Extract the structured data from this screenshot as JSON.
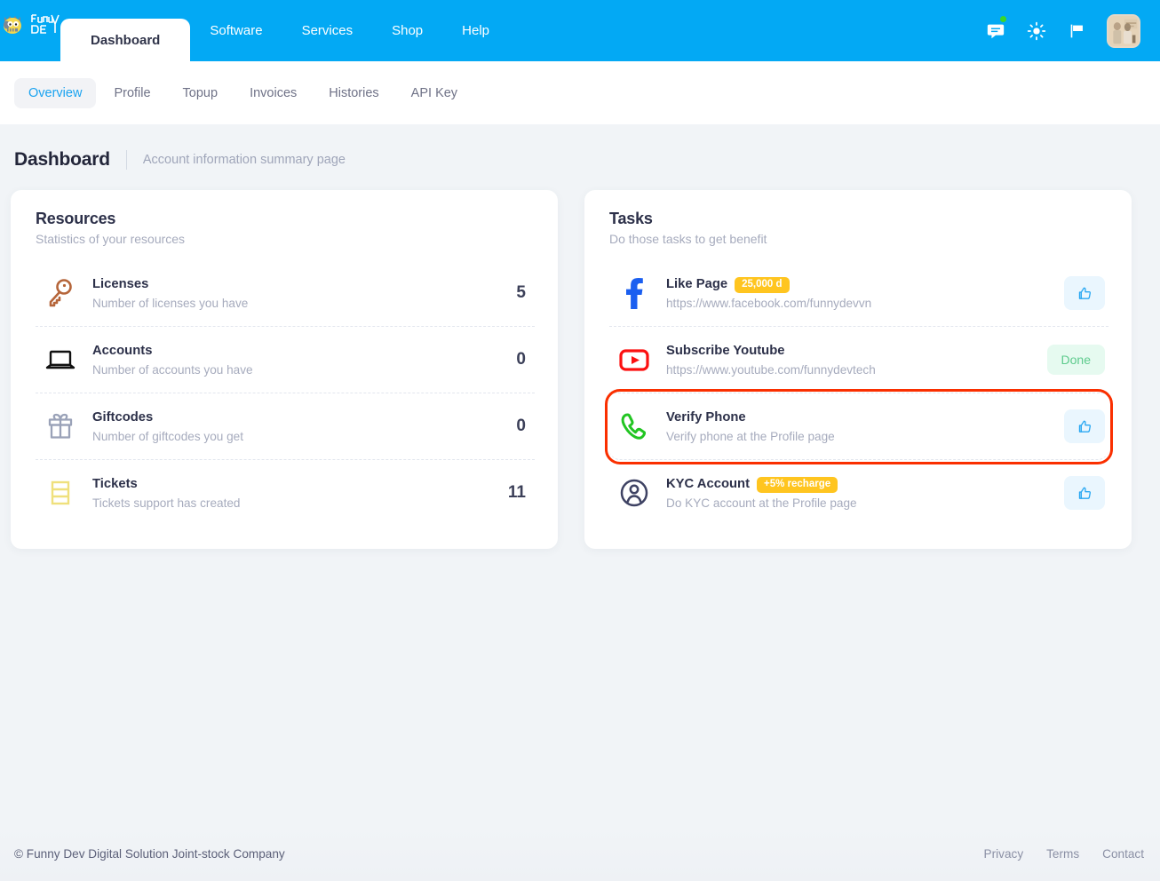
{
  "header": {
    "logo_alt": "funnydev-logo",
    "nav": [
      {
        "label": "Dashboard",
        "active": true
      },
      {
        "label": "Software",
        "active": false
      },
      {
        "label": "Services",
        "active": false
      },
      {
        "label": "Shop",
        "active": false
      },
      {
        "label": "Help",
        "active": false
      }
    ],
    "icons": [
      {
        "name": "chat-icon",
        "glyph": "chat",
        "has_dot": true
      },
      {
        "name": "brightness-icon",
        "glyph": "sun",
        "has_dot": false
      },
      {
        "name": "flag-icon",
        "glyph": "flag",
        "has_dot": false
      }
    ],
    "avatar_name": "user-avatar",
    "brand_color": "#03A9F4",
    "notification_dot_color": "#3ad62b"
  },
  "subnav": {
    "items": [
      {
        "label": "Overview",
        "active": true
      },
      {
        "label": "Profile",
        "active": false
      },
      {
        "label": "Topup",
        "active": false
      },
      {
        "label": "Invoices",
        "active": false
      },
      {
        "label": "Histories",
        "active": false
      },
      {
        "label": "API Key",
        "active": false
      }
    ]
  },
  "page": {
    "title": "Dashboard",
    "subtitle": "Account information summary page"
  },
  "resources": {
    "title": "Resources",
    "subtitle": "Statistics of your resources",
    "items": [
      {
        "icon": "key-icon",
        "icon_color": "#b5653a",
        "label": "Licenses",
        "desc": "Number of licenses you have",
        "value": "5"
      },
      {
        "icon": "laptop-icon",
        "icon_color": "#111111",
        "label": "Accounts",
        "desc": "Number of accounts you have",
        "value": "0"
      },
      {
        "icon": "gift-icon",
        "icon_color": "#9aa2b8",
        "label": "Giftcodes",
        "desc": "Number of giftcodes you get",
        "value": "0"
      },
      {
        "icon": "ticket-icon",
        "icon_color": "#f0e07a",
        "label": "Tickets",
        "desc": "Tickets support has created",
        "value": "11"
      }
    ]
  },
  "tasks": {
    "title": "Tasks",
    "subtitle": "Do those tasks to get benefit",
    "items": [
      {
        "icon": "facebook-icon",
        "label": "Like Page",
        "badge": "25,000 d",
        "desc": "https://www.facebook.com/funnydevvn",
        "action": "thumbs-up",
        "action_label": "",
        "highlighted": false
      },
      {
        "icon": "youtube-icon",
        "label": "Subscribe Youtube",
        "badge": "",
        "desc": "https://www.youtube.com/funnydevtech",
        "action": "done",
        "action_label": "Done",
        "highlighted": false
      },
      {
        "icon": "phone-icon",
        "label": "Verify Phone",
        "badge": "",
        "desc": "Verify phone at the Profile page",
        "action": "thumbs-up",
        "action_label": "",
        "highlighted": true
      },
      {
        "icon": "user-circle-icon",
        "label": "KYC Account",
        "badge": "+5% recharge",
        "desc": "Do KYC account at the Profile page",
        "action": "thumbs-up",
        "action_label": "",
        "highlighted": false
      }
    ],
    "badge_color": "#FFC520",
    "done_color": "#5ecb8d",
    "highlight_color": "#fa2f00"
  },
  "footer": {
    "copyright": "© Funny Dev Digital Solution Joint-stock Company",
    "links": [
      "Privacy",
      "Terms",
      "Contact"
    ]
  }
}
